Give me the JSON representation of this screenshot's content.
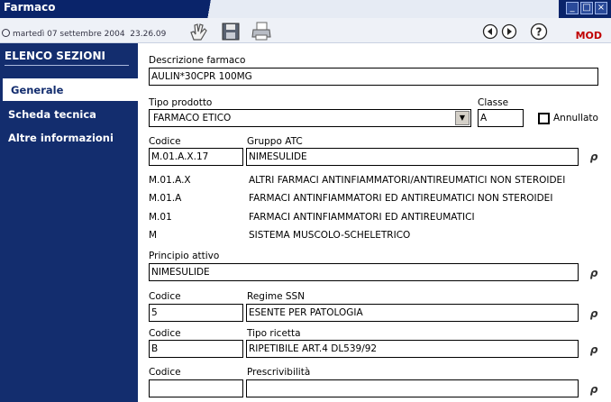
{
  "window": {
    "title": "Farmaco"
  },
  "toolbar": {
    "date": "martedì 07 settembre 2004",
    "time": "23.26.09",
    "mode": "MOD",
    "icons": [
      "clock-icon",
      "hand-icon",
      "save-icon",
      "print-icon",
      "back-icon",
      "forward-icon",
      "help-icon"
    ]
  },
  "sidebar": {
    "title": "ELENCO SEZIONI",
    "items": [
      {
        "label": "Generale",
        "active": true
      },
      {
        "label": "Scheda tecnica",
        "active": false
      },
      {
        "label": "Altre informazioni",
        "active": false
      }
    ]
  },
  "form": {
    "descrizione": {
      "label": "Descrizione farmaco",
      "value": "AULIN*30CPR 100MG"
    },
    "tipo_prodotto": {
      "label": "Tipo prodotto",
      "value": "FARMACO ETICO"
    },
    "classe": {
      "label": "Classe",
      "value": "A"
    },
    "annullato": {
      "label": "Annullato",
      "checked": false
    },
    "atc": {
      "code_label": "Codice",
      "group_label": "Gruppo ATC",
      "code": "M.01.A.X.17",
      "group": "NIMESULIDE",
      "hierarchy": [
        {
          "code": "M.01.A.X",
          "desc": "ALTRI FARMACI ANTINFIAMMATORI/ANTIREUMATICI NON STEROIDEI"
        },
        {
          "code": "M.01.A",
          "desc": "FARMACI ANTINFIAMMATORI ED ANTIREUMATICI NON STEROIDEI"
        },
        {
          "code": "M.01",
          "desc": "FARMACI ANTINFIAMMATORI ED ANTIREUMATICI"
        },
        {
          "code": "M",
          "desc": "SISTEMA MUSCOLO-SCHELETRICO"
        }
      ]
    },
    "principio": {
      "label": "Principio attivo",
      "value": "NIMESULIDE"
    },
    "regime": {
      "code_label": "Codice",
      "label": "Regime SSN",
      "code": "5",
      "value": "ESENTE PER PATOLOGIA"
    },
    "ricetta": {
      "code_label": "Codice",
      "label": "Tipo ricetta",
      "code": "B",
      "value": "RIPETIBILE ART.4 DL539/92"
    },
    "prescrivibilita": {
      "code_label": "Codice",
      "label": "Prescrivibilità",
      "code": "",
      "value": ""
    }
  },
  "colors": {
    "titlebar": "#0a246a",
    "sidebar": "#132d6e",
    "mode": "#c00000"
  }
}
